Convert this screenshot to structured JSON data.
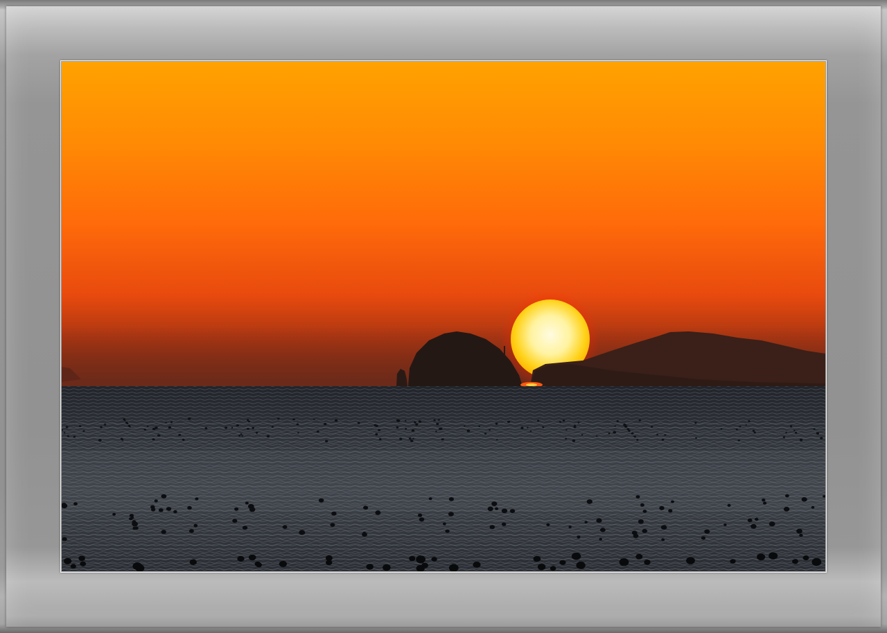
{
  "photo": {
    "subject": "sunset-over-sea",
    "colors": {
      "sky_top": "#ffa000",
      "sky_mid": "#ff6a0a",
      "sky_low": "#d8400e",
      "haze": "#8a2f14",
      "sun_core": "#fff7c0",
      "sun_edge": "#ffcf10",
      "sun_glow": "#ff2a00",
      "island": "#1f1713",
      "sea_dark": "#1e2126",
      "sea_light": "#4a4f57",
      "frame": "#9a9a9a"
    }
  }
}
